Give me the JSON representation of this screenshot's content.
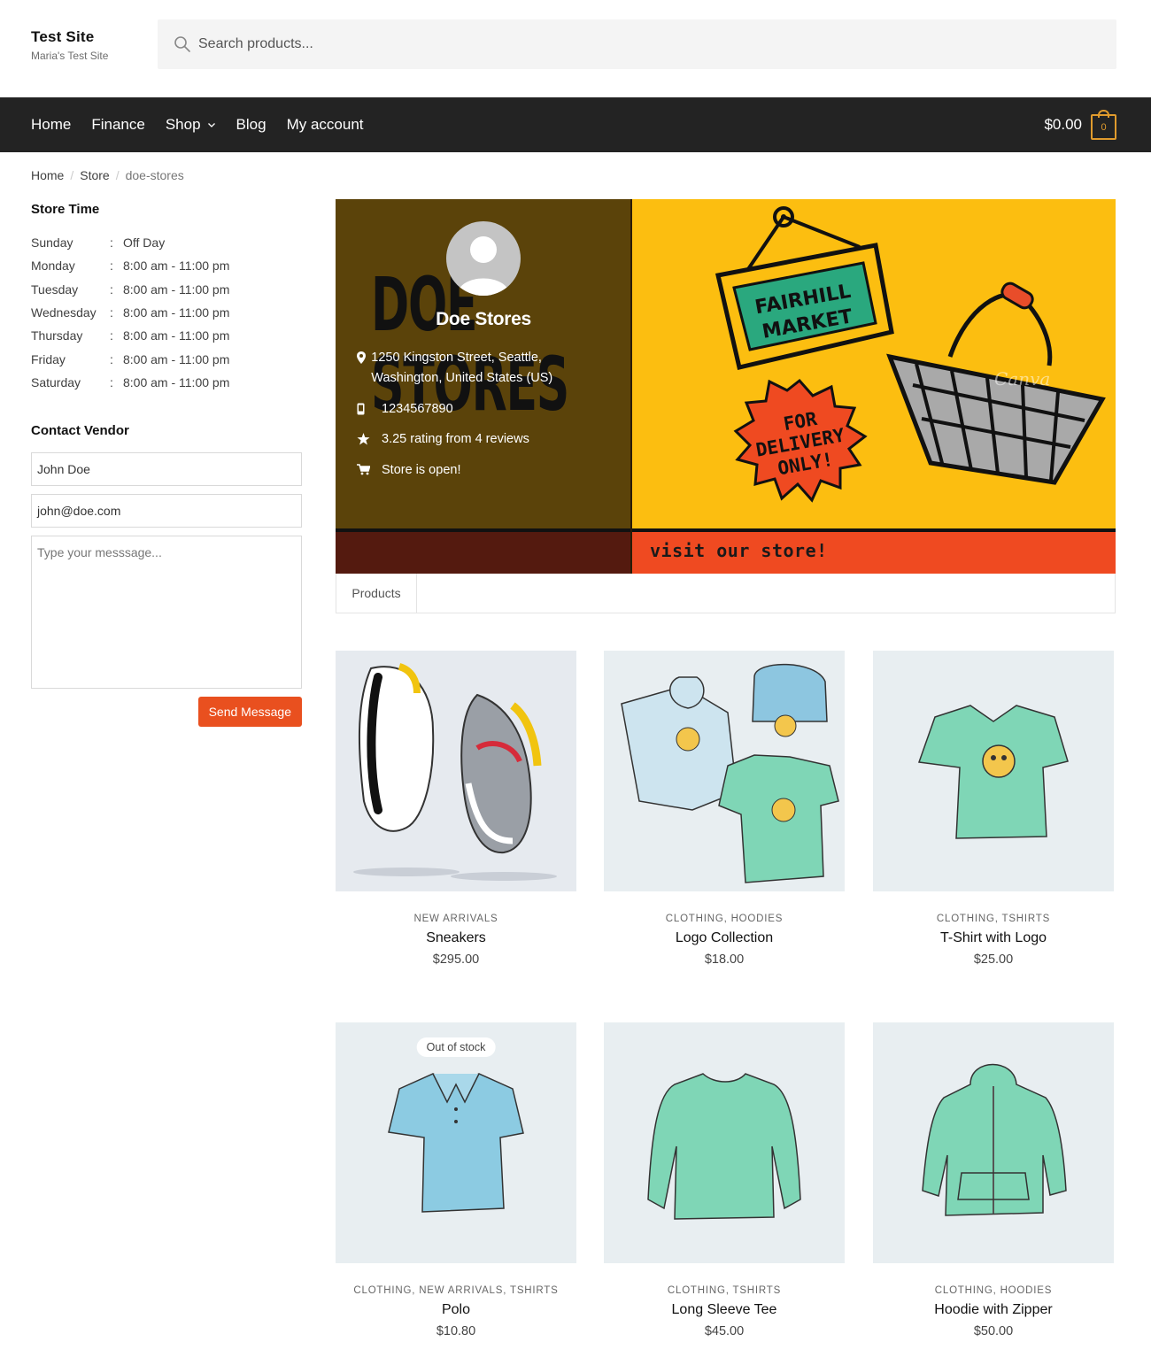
{
  "site": {
    "title": "Test Site",
    "tagline": "Maria's Test Site"
  },
  "search": {
    "placeholder": "Search products..."
  },
  "nav": {
    "items": [
      {
        "label": "Home"
      },
      {
        "label": "Finance"
      },
      {
        "label": "Shop"
      },
      {
        "label": "Blog"
      },
      {
        "label": "My account"
      }
    ]
  },
  "cart": {
    "amount": "$0.00",
    "count": "0"
  },
  "breadcrumb": {
    "home": "Home",
    "store": "Store",
    "current": "doe-stores"
  },
  "store_time": {
    "title": "Store Time",
    "rows": [
      {
        "day": "Sunday",
        "hours": "Off Day"
      },
      {
        "day": "Monday",
        "hours": "8:00 am - 11:00 pm"
      },
      {
        "day": "Tuesday",
        "hours": "8:00 am - 11:00 pm"
      },
      {
        "day": "Wednesday",
        "hours": "8:00 am - 11:00 pm"
      },
      {
        "day": "Thursday",
        "hours": "8:00 am - 11:00 pm"
      },
      {
        "day": "Friday",
        "hours": "8:00 am - 11:00 pm"
      },
      {
        "day": "Saturday",
        "hours": "8:00 am - 11:00 pm"
      }
    ]
  },
  "contact": {
    "title": "Contact Vendor",
    "name_value": "John Doe",
    "email_value": "john@doe.com",
    "message_placeholder": "Type your messsage...",
    "send_label": "Send Message"
  },
  "store": {
    "name": "Doe Stores",
    "address": "1250 Kingston Street, Seattle, Washington, United States (US)",
    "phone": "1234567890",
    "rating": "3.25 rating from 4 reviews",
    "status": "Store is open!",
    "banner_bg_text_1": "DOE",
    "banner_bg_text_2": "STORES",
    "banner_sign": "FAIRHILL MARKET",
    "banner_badge": "FOR DELIVERY ONLY!",
    "banner_cta": "visit our store!",
    "banner_watermark": "Canva"
  },
  "tabs": [
    {
      "label": "Products"
    }
  ],
  "products": [
    {
      "categories": "NEW ARRIVALS",
      "title": "Sneakers",
      "price": "$295.00",
      "badge": ""
    },
    {
      "categories": "CLOTHING, HOODIES",
      "title": "Logo Collection",
      "price": "$18.00",
      "badge": ""
    },
    {
      "categories": "CLOTHING, TSHIRTS",
      "title": "T-Shirt with Logo",
      "price": "$25.00",
      "badge": ""
    },
    {
      "categories": "CLOTHING, NEW ARRIVALS, TSHIRTS",
      "title": "Polo",
      "price": "$10.80",
      "badge": "Out of stock"
    },
    {
      "categories": "CLOTHING, TSHIRTS",
      "title": "Long Sleeve Tee",
      "price": "$45.00",
      "badge": ""
    },
    {
      "categories": "CLOTHING, HOODIES",
      "title": "Hoodie with Zipper",
      "price": "$50.00",
      "badge": ""
    }
  ],
  "colors": {
    "nav_bg": "#232323",
    "accent": "#e9501f",
    "cart_accent": "#e09b2d",
    "banner_yellow": "#fcbe10",
    "banner_brown": "#5b430a"
  }
}
